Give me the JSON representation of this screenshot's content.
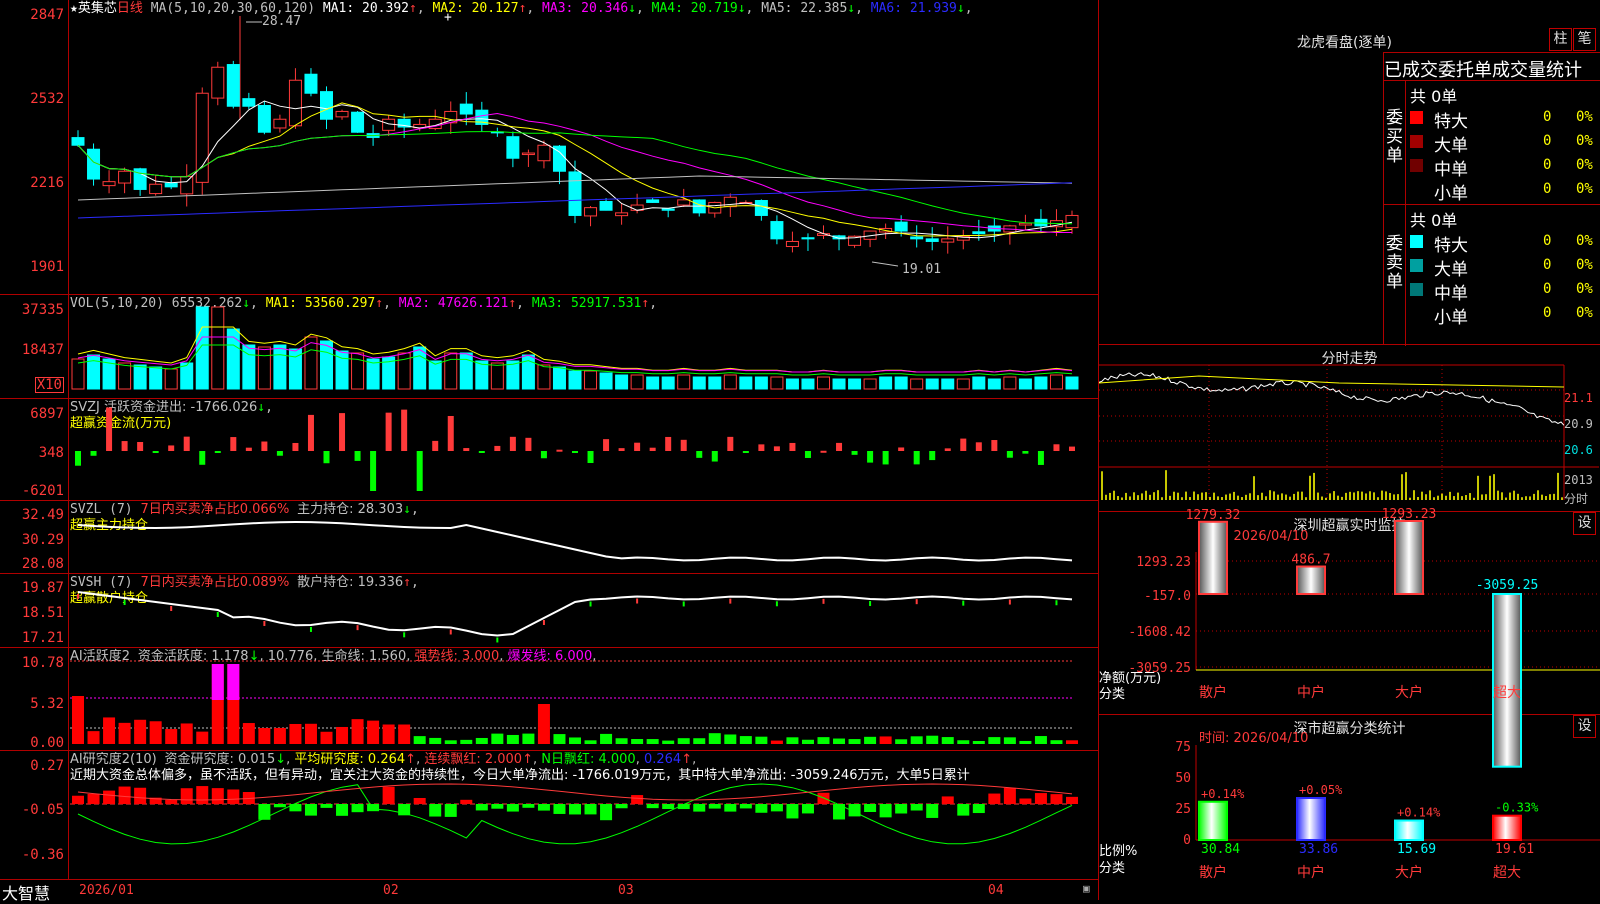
{
  "stock": {
    "name": "英集芯",
    "period": "日线",
    "high_mark": "28.47",
    "low_mark": "19.01"
  },
  "ma_line": {
    "prefix": "MA(5,10,20,30,60,120)",
    "items": [
      {
        "label": "MA1: 20.392",
        "arrow": "↑",
        "color": "#ffffff"
      },
      {
        "label": "MA2: 20.127",
        "arrow": "↑",
        "color": "#ffff00"
      },
      {
        "label": "MA3: 20.346",
        "arrow": "↓",
        "color": "#ff00ff"
      },
      {
        "label": "MA4: 20.719",
        "arrow": "↓",
        "color": "#00ff00"
      },
      {
        "label": "MA5: 22.385",
        "arrow": "↓",
        "color": "#c0c0c0"
      },
      {
        "label": "MA6: 21.939",
        "arrow": "↓",
        "color": "#2b2bff"
      }
    ]
  },
  "price_axis": [
    "2847",
    "2532",
    "2216",
    "1901"
  ],
  "vol_line": {
    "prefix": "VOL(5,10,20)",
    "items": [
      {
        "label": "65532.262",
        "arrow": "↓",
        "color": "#c0c0c0"
      },
      {
        "label": "MA1: 53560.297",
        "arrow": "↑",
        "color": "#ffff00"
      },
      {
        "label": "MA2: 47626.121",
        "arrow": "↑",
        "color": "#ff00ff"
      },
      {
        "label": "MA3: 52917.531",
        "arrow": "↑",
        "color": "#00ff00"
      }
    ]
  },
  "vol_axis": [
    "37335",
    "18437"
  ],
  "vol_unit": "X10",
  "svzj": {
    "label": "SVZJ  活跃资金进出: -1766.026",
    "arrow": "↓",
    "tail": ",",
    "sub": "超赢资金流(万元)",
    "axis": [
      "6897",
      "348",
      "-6201"
    ]
  },
  "svzl": {
    "name": "SVZL (7)",
    "ratio": "7日内买卖净占比0.066%",
    "hold": "主力持仓: 28.303",
    "arrow": "↓",
    "tail": ",",
    "sub": "超赢主力持仓",
    "axis": [
      "32.49",
      "30.29",
      "28.08"
    ]
  },
  "svsh": {
    "name": "SVSH (7)",
    "ratio": "7日内买卖净占比0.089%",
    "hold": "散户持仓: 19.336",
    "arrow": "↑",
    "tail": ",",
    "sub": "超赢散户持仓",
    "axis": [
      "19.87",
      "18.51",
      "17.21"
    ]
  },
  "ai_active": {
    "name": "AI活跃度2",
    "items": [
      {
        "label": "资金活跃度: 1.178",
        "arrow": "↓",
        "color": "#c0c0c0"
      },
      {
        "label": "10.776",
        "arrow": "",
        "color": "#c0c0c0"
      },
      {
        "label": "生命线: 1.560",
        "arrow": "",
        "color": "#c0c0c0"
      },
      {
        "label": "强势线: 3.000",
        "arrow": "",
        "color": "#ff3a3a"
      },
      {
        "label": "爆发线: 6.000",
        "arrow": "",
        "color": "#ff00ff"
      }
    ],
    "axis": [
      "10.78",
      "5.32",
      "0.00"
    ]
  },
  "ai_research": {
    "name": "AI研究度2(10)",
    "items": [
      {
        "label": "资金研究度: 0.015",
        "arrow": "↓",
        "color": "#c0c0c0"
      },
      {
        "label": "平均研究度: 0.264",
        "arrow": "↑",
        "color": "#ffff00"
      },
      {
        "label": "连续飘红: 2.000",
        "arrow": "↑",
        "color": "#ff3a3a"
      },
      {
        "label": "N日飘红: 4.000",
        "arrow": "",
        "color": "#00ff00"
      },
      {
        "label": "0.264",
        "arrow": "↑",
        "color": "#2b2bff"
      }
    ],
    "comment": "近期大资金总体偏多，虽不活跃，但有异动，宜关注大资金的持续性，今日大单净流出: -1766.019万元，其中特大单净流出: -3059.246万元，大单5日累计",
    "axis": [
      "0.27",
      "-0.05",
      "-0.36"
    ]
  },
  "time_axis": {
    "brand": "大智慧",
    "labels": [
      "2026/01",
      "02",
      "03",
      "04"
    ]
  },
  "dragon": {
    "title": "龙虎看盘(逐单)",
    "btn_pillar": "柱",
    "btn_pen": "笔",
    "subtitle": "已成交委托单成交量统计",
    "buy": {
      "side": "委买单",
      "total": "共 0单",
      "rows": [
        {
          "name": "特大",
          "count": "0",
          "pct": "0%",
          "color": "#ff0000"
        },
        {
          "name": "大单",
          "count": "0",
          "pct": "0%",
          "color": "#a00000"
        },
        {
          "name": "中单",
          "count": "0",
          "pct": "0%",
          "color": "#700000"
        },
        {
          "name": "小单",
          "count": "0",
          "pct": "0%",
          "color": "#000000"
        }
      ]
    },
    "sell": {
      "side": "委卖单",
      "total": "共 0单",
      "rows": [
        {
          "name": "特大",
          "count": "0",
          "pct": "0%",
          "color": "#00ffff"
        },
        {
          "name": "大单",
          "count": "0",
          "pct": "0%",
          "color": "#00a0a0"
        },
        {
          "name": "中单",
          "count": "0",
          "pct": "0%",
          "color": "#007878"
        },
        {
          "name": "小单",
          "count": "0",
          "pct": "0%",
          "color": "#000000"
        }
      ]
    }
  },
  "intraday": {
    "title": "分时走势",
    "axis": [
      "21.1",
      "20.9",
      "20.6"
    ],
    "vol_axis": [
      "2013",
      "分时"
    ]
  },
  "monitor": {
    "title": "深圳超赢实时监控",
    "btn": "设",
    "time": "时间: 2026/04/10",
    "axis": [
      "1293.23",
      "-157.0",
      "-1608.42",
      "-3059.25"
    ],
    "y_caption": "净额(万元)",
    "x_caption": "分类",
    "bars": [
      {
        "name": "散户",
        "value": "1279.32"
      },
      {
        "name": "中户",
        "value": "486.7"
      },
      {
        "name": "大户",
        "value": "1293.23"
      },
      {
        "name": "超大",
        "value": "-3059.25"
      }
    ]
  },
  "classify": {
    "title": "深市超赢分类统计",
    "btn": "设",
    "time": "时间: 2026/04/10",
    "axis": [
      "75",
      "50",
      "25",
      "0"
    ],
    "y_caption": "比例%",
    "x_caption": "分类",
    "bars": [
      {
        "name": "散户",
        "value": "30.84",
        "change": "+0.14%",
        "color": "#00ff00"
      },
      {
        "name": "中户",
        "value": "33.86",
        "change": "+0.05%",
        "color": "#2b2bff"
      },
      {
        "name": "大户",
        "value": "15.69",
        "change": "+0.14%",
        "color": "#00ffff"
      },
      {
        "name": "超大",
        "value": "19.61",
        "change": "-0.33%",
        "color": "#ff0000"
      }
    ]
  }
}
